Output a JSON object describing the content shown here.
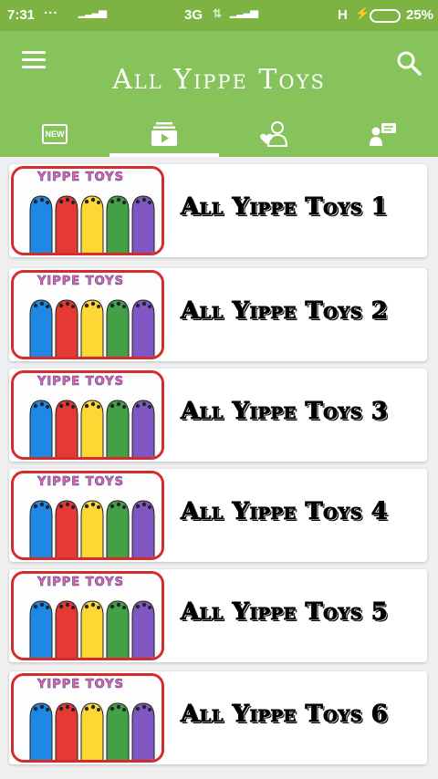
{
  "status_bar": {
    "time": "7:31",
    "dots": "...",
    "network": "3G",
    "network2": "H",
    "battery": "25%"
  },
  "app": {
    "title": "All Yippe Toys"
  },
  "tabs": [
    {
      "name": "new",
      "label": "NEW",
      "icon": "new-badge-icon",
      "active": false
    },
    {
      "name": "videos",
      "icon": "video-playlist-icon",
      "active": true
    },
    {
      "name": "people",
      "icon": "heart-person-icon",
      "active": false
    },
    {
      "name": "chat",
      "icon": "person-chat-icon",
      "active": false
    }
  ],
  "items": [
    {
      "title": "All Yippe Toys 1",
      "thumb_text": "YIPPE TOYS"
    },
    {
      "title": "All Yippe Toys 2",
      "thumb_text": "YIPPE TOYS"
    },
    {
      "title": "All Yippe Toys 3",
      "thumb_text": "YIPPE TOYS"
    },
    {
      "title": "All Yippe Toys 4",
      "thumb_text": "YIPPE TOYS"
    },
    {
      "title": "All Yippe Toys 5",
      "thumb_text": "YIPPE TOYS"
    },
    {
      "title": "All Yippe Toys 6",
      "thumb_text": "YIPPE TOYS"
    }
  ],
  "colors": {
    "appbar": "#86c35a",
    "statusbar": "#7cb342",
    "thumb_border": "#d42b2b",
    "finger_colors": [
      "#1e88e5",
      "#e53935",
      "#fdd835",
      "#43a047",
      "#7e57c2"
    ]
  }
}
